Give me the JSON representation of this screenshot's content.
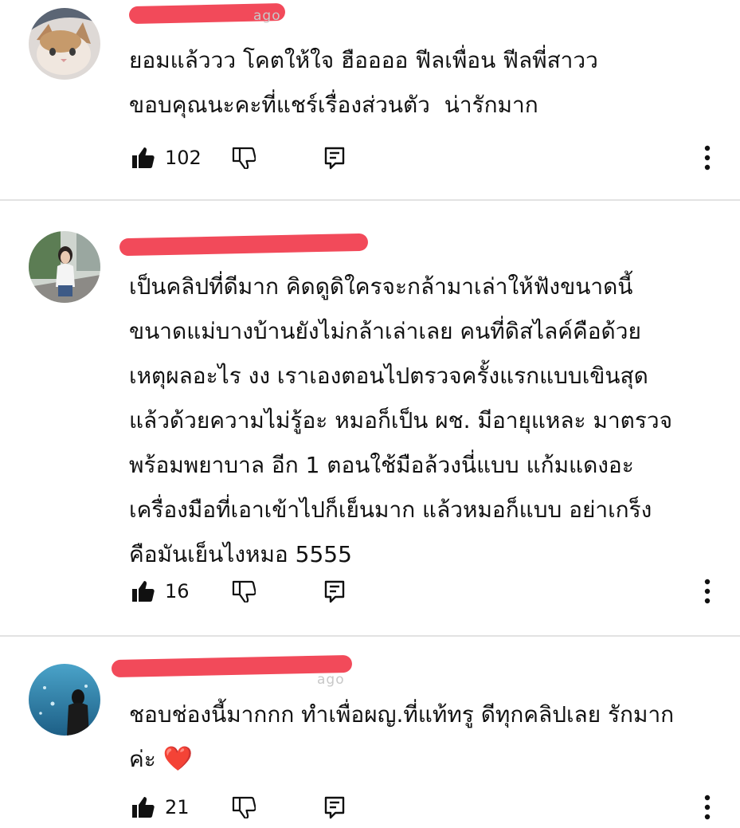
{
  "comments": [
    {
      "text": "ยอมแล้ววว โคตให้ใจ ฮืออออ ฟีลเพื่อน ฟีลพี่สาวว\nขอบคุณนะคะที่แชร์เรื่องส่วนตัว  น่ารักมาก",
      "likes": "102",
      "avatar": "cat-avatar"
    },
    {
      "text": "เป็นคลิปที่ดีมาก คิดดูดิใครจะกล้ามาเล่าให้ฟังขนาดนี้\nขนาดแม่บางบ้านยังไม่กล้าเล่าเลย คนที่ดิสไลค์คือด้วย\nเหตุผลอะไร งง เราเองตอนไปตรวจครั้งแรกแบบเขินสุด\nแล้วด้วยความไม่รู้อะ หมอก็เป็น ผช. มีอายุแหละ มาตรวจ\nพร้อมพยาบาล อีก 1 ตอนใช้มือล้วงนี่แบบ แก้มแดงอะ\nเครื่องมือที่เอาเข้าไปก็เย็นมาก แล้วหมอก็แบบ อย่าเกร็ง\nคือมันเย็นไงหมอ 5555",
      "likes": "16",
      "avatar": "woman-street-avatar"
    },
    {
      "text": "ชอบช่องนี้มากกก ทำเพื่อผญ.ที่แท้ทรู ดีทุกคลิปเลย รักมาก\nค่ะ",
      "emoji": "❤️",
      "likes": "21",
      "avatar": "aquarium-avatar"
    }
  ],
  "meta_fragments": [
    "ago",
    "ago"
  ],
  "icons": {
    "like": "thumb-up-icon",
    "dislike": "thumb-down-icon",
    "reply": "reply-icon",
    "more": "more-vert-icon"
  },
  "colors": {
    "redaction": "#f24a5a",
    "divider": "#e2e2e2",
    "heart": "#e0203a"
  }
}
